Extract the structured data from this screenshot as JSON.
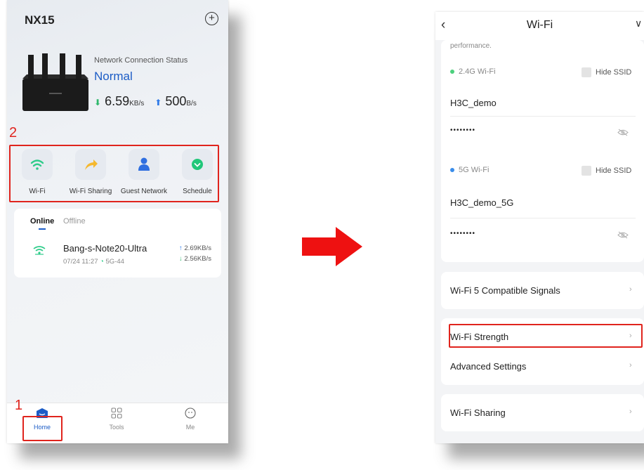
{
  "left": {
    "model": "NX15",
    "status_label": "Network Connection Status",
    "status_value": "Normal",
    "download_speed": "6.59",
    "download_unit": "KB/s",
    "upload_speed": "500",
    "upload_unit": "B/s",
    "quick_actions": [
      {
        "label": "Wi-Fi",
        "icon": "wifi-icon",
        "color": "#2ecc8a"
      },
      {
        "label": "Wi-Fi Sharing",
        "icon": "share-arrow-icon",
        "color": "#f5b82e"
      },
      {
        "label": "Guest Network",
        "icon": "guest-user-icon",
        "color": "#2f6fe0"
      },
      {
        "label": "Schedule",
        "icon": "schedule-icon",
        "color": "#21c77a"
      }
    ],
    "tabs": {
      "online": "Online",
      "offline": "Offline"
    },
    "device": {
      "name": "Bang-s-Note20-Ultra",
      "time": "07/24 11:27",
      "band": "5G-44",
      "up": "2.69KB/s",
      "down": "2.56KB/s"
    },
    "nav": {
      "home": "Home",
      "tools": "Tools",
      "me": "Me"
    },
    "annotations": {
      "box_1": "1",
      "box_2": "2"
    }
  },
  "right": {
    "title": "Wi-Fi",
    "truncated_text": "performance.",
    "band_24": {
      "label": "2.4G Wi-Fi",
      "hide_ssid": "Hide SSID",
      "ssid": "H3C_demo",
      "password": "••••••••",
      "dot_color": "#4cd07d"
    },
    "band_5": {
      "label": "5G Wi-Fi",
      "hide_ssid": "Hide SSID",
      "ssid": "H3C_demo_5G",
      "password": "••••••••",
      "dot_color": "#3a8dea"
    },
    "menu": {
      "compatible": "Wi-Fi 5 Compatible Signals",
      "strength": "Wi-Fi Strength",
      "advanced": "Advanced Settings",
      "sharing": "Wi-Fi Sharing"
    }
  },
  "colors": {
    "accent": "#1c5cc6",
    "annotation": "#e0241d"
  }
}
